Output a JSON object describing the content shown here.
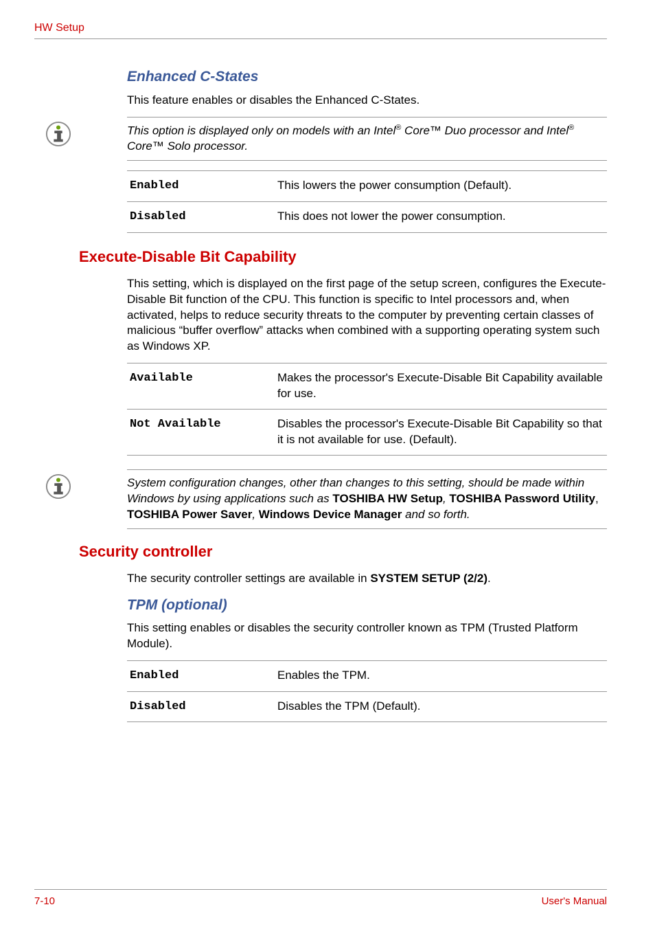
{
  "header": "HW Setup",
  "sec1": {
    "title": "Enhanced C-States",
    "intro": "This feature enables or disables the Enhanced C-States.",
    "callout_pre": "This option is displayed only on models with an Intel",
    "callout_mid": " Core™ Duo processor and Intel",
    "callout_post": " Core™ Solo processor.",
    "rows": [
      {
        "k": "Enabled",
        "v": "This lowers the power consumption (Default)."
      },
      {
        "k": "Disabled",
        "v": "This does not lower the power consumption."
      }
    ]
  },
  "sec2": {
    "title": "Execute-Disable Bit Capability",
    "para": "This setting, which is displayed on the first page of the setup screen, configures the Execute-Disable Bit function of the CPU. This function is specific to Intel processors and, when activated, helps to reduce security threats to the computer by preventing certain classes of malicious “buffer overflow” attacks when combined with a supporting operating system such as Windows XP.",
    "rows": [
      {
        "k": "Available",
        "v": "Makes the processor's Execute-Disable Bit Capability available for use."
      },
      {
        "k": "Not Available",
        "v": "Disables the processor's Execute-Disable Bit Capability so that it is not available for use. (Default)."
      }
    ],
    "callout_p1": "System configuration changes, other than changes to this setting, should be made within Windows by using applications such as ",
    "callout_b1": "TOSHIBA HW Setup",
    "callout_s1": ", ",
    "callout_b2": "TOSHIBA Password Utility",
    "callout_s2": ", ",
    "callout_b3": "TOSHIBA Power Saver",
    "callout_s3": ", ",
    "callout_b4": "Windows Device Manager",
    "callout_p2": " and so forth."
  },
  "sec3": {
    "title": "Security controller",
    "intro_pre": "The security controller settings are available in ",
    "intro_bold": "SYSTEM SETUP (2/2)",
    "intro_post": ".",
    "sub": {
      "title": "TPM (optional)",
      "intro": "This setting enables or disables the security controller known as TPM (Trusted Platform Module).",
      "rows": [
        {
          "k": "Enabled",
          "v": "Enables the TPM."
        },
        {
          "k": "Disabled",
          "v": "Disables the TPM (Default)."
        }
      ]
    }
  },
  "footer": {
    "page": "7-10",
    "manual": "User's Manual"
  }
}
